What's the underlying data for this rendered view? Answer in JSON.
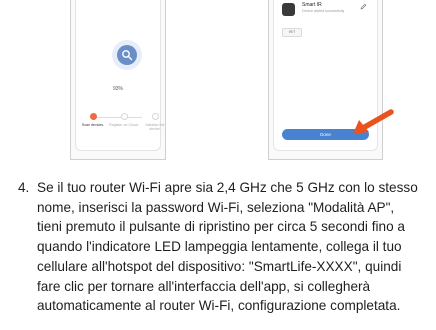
{
  "left_screen": {
    "progress": "93%",
    "steps": [
      {
        "label": "Scan devices.",
        "active": true
      },
      {
        "label": "Register on Cloud.",
        "active": false
      },
      {
        "label": "Initialize the device.",
        "active": false
      }
    ]
  },
  "right_screen": {
    "device_name": "Smart IR",
    "device_status": "Device added successfully",
    "room_tag": "IR/T",
    "done_label": "Done"
  },
  "colors": {
    "accent_orange": "#f26a3d",
    "accent_blue": "#4a82d2"
  },
  "instructions": {
    "number": "4.",
    "lines": [
      "Se il tuo router Wi-Fi apre sia 2,4 GHz che 5 GHz con lo stesso",
      "nome, inserisci la password Wi-Fi, seleziona \"Modalità AP\",",
      "tieni premuto il pulsante di ripristino per circa 5 secondi fino a",
      "quando l'indicatore LED lampeggia lentamente, collega il tuo",
      "cellulare all'hotspot del dispositivo: \"SmartLife-XXXX\", quindi",
      "fare clic per tornare all'interfaccia dell'app, si collegherà",
      "automaticamente al router Wi-Fi, configurazione completata."
    ]
  }
}
